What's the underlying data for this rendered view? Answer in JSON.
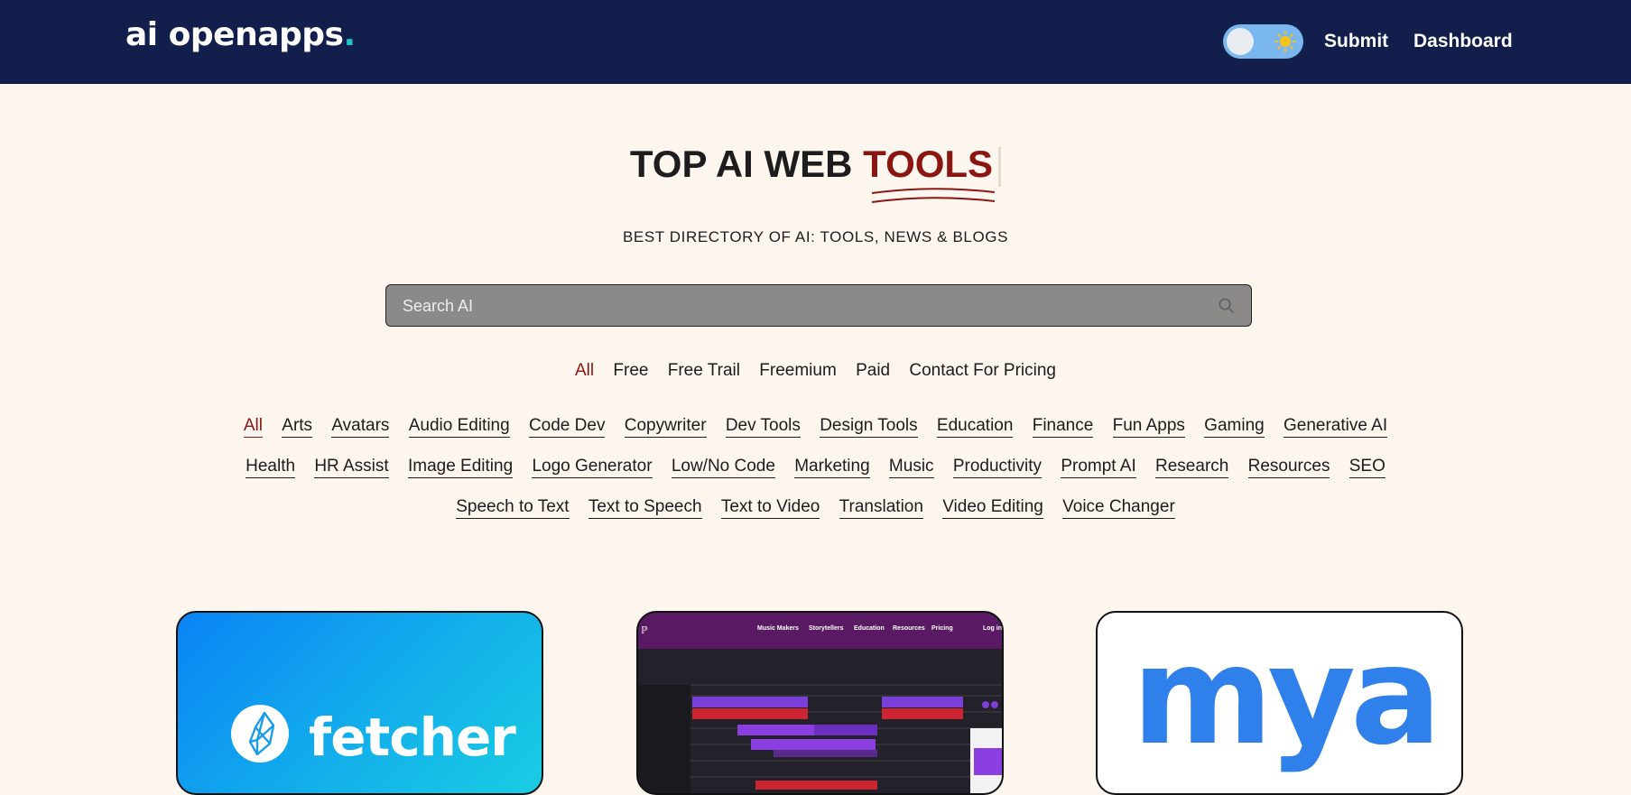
{
  "header": {
    "logo_main": "ai openapps",
    "logo_dot": ".",
    "submit_label": "Submit",
    "dashboard_label": "Dashboard"
  },
  "hero": {
    "title_prefix": "TOP AI WEB ",
    "title_accent": "TOOLS",
    "subtitle": "BEST DIRECTORY OF AI: TOOLS, NEWS & BLOGS"
  },
  "search": {
    "placeholder": "Search AI"
  },
  "pricing_filters": [
    "All",
    "Free",
    "Free Trail",
    "Freemium",
    "Paid",
    "Contact For Pricing"
  ],
  "categories": {
    "row1": [
      "All",
      "Arts",
      "Avatars",
      "Audio Editing",
      "Code Dev",
      "Copywriter",
      "Dev Tools",
      "Design Tools",
      "Education",
      "Finance",
      "Fun Apps",
      "Gaming",
      "Generative AI"
    ],
    "row2": [
      "Health",
      "HR Assist",
      "Image Editing",
      "Logo Generator",
      "Low/No Code",
      "Marketing",
      "Music",
      "Productivity",
      "Prompt AI",
      "Research",
      "Resources",
      "SEO"
    ],
    "row3": [
      "Speech to Text",
      "Text to Speech",
      "Text to Video",
      "Translation",
      "Video Editing",
      "Voice Changer"
    ]
  },
  "cards": {
    "card1_brand": "fetcher",
    "card2_nav": [
      "Music Makers",
      "Storytellers",
      "Education",
      "Resources",
      "Pricing",
      "Log in"
    ],
    "card3_brand": "mya"
  },
  "colors": {
    "header_bg": "#121e4b",
    "page_bg": "#fdf6ef",
    "accent": "#8b1611",
    "logo_dot": "#1fc6c8"
  }
}
